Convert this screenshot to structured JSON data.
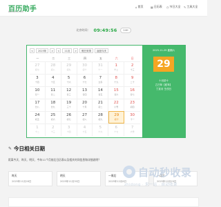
{
  "header": {
    "logo": "百历助手",
    "logo_sub": "bailizhu.com",
    "nav": [
      {
        "icon": "home-icon",
        "glyph": "⌂",
        "label": "首页"
      },
      {
        "icon": "calendar-icon",
        "glyph": "▦",
        "label": "日历表"
      },
      {
        "icon": "clock-icon",
        "glyph": "◷",
        "label": "节日大全"
      },
      {
        "icon": "tool-icon",
        "glyph": "✎",
        "label": "工具大全"
      }
    ]
  },
  "time": {
    "label": "北京时间：",
    "clock": "09:49:56",
    "button": "24H"
  },
  "calendar": {
    "controls": {
      "prev": "<",
      "year": "2025年",
      "next": ">",
      "month": "11月",
      "festival": "假日安排",
      "today": "返回今天"
    },
    "weekdays": [
      "一",
      "二",
      "三",
      "四",
      "五",
      "六",
      "日"
    ],
    "days": [
      {
        "d": "27",
        "l": "初七",
        "other": true
      },
      {
        "d": "28",
        "l": "初八",
        "other": true
      },
      {
        "d": "29",
        "l": "初九",
        "other": true
      },
      {
        "d": "30",
        "l": "初十",
        "other": true
      },
      {
        "d": "31",
        "l": "十一",
        "other": true
      },
      {
        "d": "1",
        "l": "十二",
        "wk": true
      },
      {
        "d": "2",
        "l": "十三",
        "wk": true
      },
      {
        "d": "3",
        "l": "十四"
      },
      {
        "d": "4",
        "l": "十五"
      },
      {
        "d": "5",
        "l": "十六"
      },
      {
        "d": "6",
        "l": "十七"
      },
      {
        "d": "7",
        "l": "立冬"
      },
      {
        "d": "8",
        "l": "十九",
        "wk": true
      },
      {
        "d": "9",
        "l": "二十",
        "wk": true
      },
      {
        "d": "10",
        "l": "廿一"
      },
      {
        "d": "11",
        "l": "廿二"
      },
      {
        "d": "12",
        "l": "廿三"
      },
      {
        "d": "13",
        "l": "廿四"
      },
      {
        "d": "14",
        "l": "廿五"
      },
      {
        "d": "15",
        "l": "廿六",
        "wk": true
      },
      {
        "d": "16",
        "l": "廿七",
        "wk": true
      },
      {
        "d": "17",
        "l": "廿八"
      },
      {
        "d": "18",
        "l": "廿九"
      },
      {
        "d": "19",
        "l": "三十"
      },
      {
        "d": "20",
        "l": "十月"
      },
      {
        "d": "21",
        "l": "初二"
      },
      {
        "d": "22",
        "l": "小雪",
        "wk": true
      },
      {
        "d": "23",
        "l": "初四",
        "wk": true
      },
      {
        "d": "24",
        "l": "初五"
      },
      {
        "d": "25",
        "l": "初六"
      },
      {
        "d": "26",
        "l": "初七"
      },
      {
        "d": "27",
        "l": "初八"
      },
      {
        "d": "28",
        "l": "初九"
      },
      {
        "d": "29",
        "l": "初十",
        "wk": true,
        "selected": true
      },
      {
        "d": "30",
        "l": "十一",
        "wk": true
      },
      {
        "d": "1",
        "l": "十二",
        "other": true
      },
      {
        "d": "2",
        "l": "十三",
        "other": true
      },
      {
        "d": "3",
        "l": "十四",
        "other": true
      },
      {
        "d": "4",
        "l": "十五",
        "other": true
      },
      {
        "d": "5",
        "l": "十六",
        "other": true
      },
      {
        "d": "6",
        "l": "十七",
        "other": true
      },
      {
        "d": "7",
        "l": "大雪",
        "other": true
      }
    ]
  },
  "side": {
    "date": "2025-11-29 星期六",
    "day": "29",
    "lunar": "十月初十",
    "ganzhi": "乙巳年【蛇年】",
    "ganzhi2": "丁亥月 壬戌日"
  },
  "section": {
    "icon": "pin-icon",
    "title": "今日相关日期",
    "desc": "距离今天、昨天、明天、今年11个月前后日历表以及相关时间信息和详细说明？",
    "cards": [
      {
        "name": "昨天",
        "date": "2025年11月28日"
      },
      {
        "name": "明天",
        "date": "2025年11月30日"
      },
      {
        "name": "一周后",
        "date": "2025年12月6日"
      },
      {
        "name": "一月后",
        "date": "2025年12月29日"
      }
    ]
  },
  "watermark": {
    "text": "自动秒收录",
    "sub": "zhidong · 来一站 · 自动收录"
  }
}
